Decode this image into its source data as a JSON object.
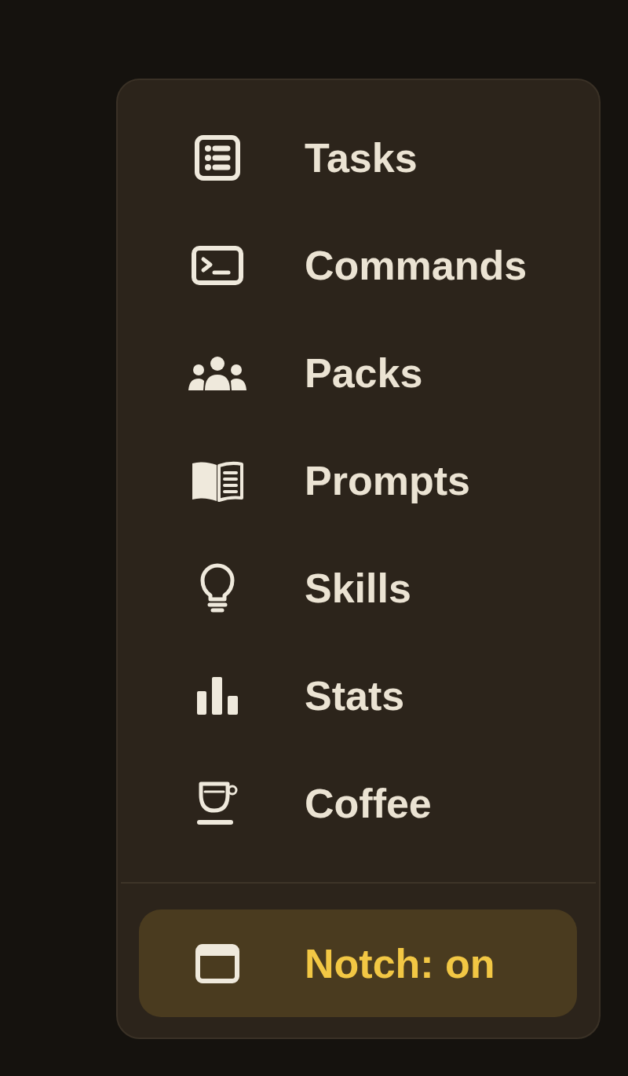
{
  "menu": {
    "items": [
      {
        "label": "Tasks"
      },
      {
        "label": "Commands"
      },
      {
        "label": "Packs"
      },
      {
        "label": "Prompts"
      },
      {
        "label": "Skills"
      },
      {
        "label": "Stats"
      },
      {
        "label": "Coffee"
      }
    ],
    "toggle": {
      "label": "Notch: on",
      "on": true
    }
  }
}
